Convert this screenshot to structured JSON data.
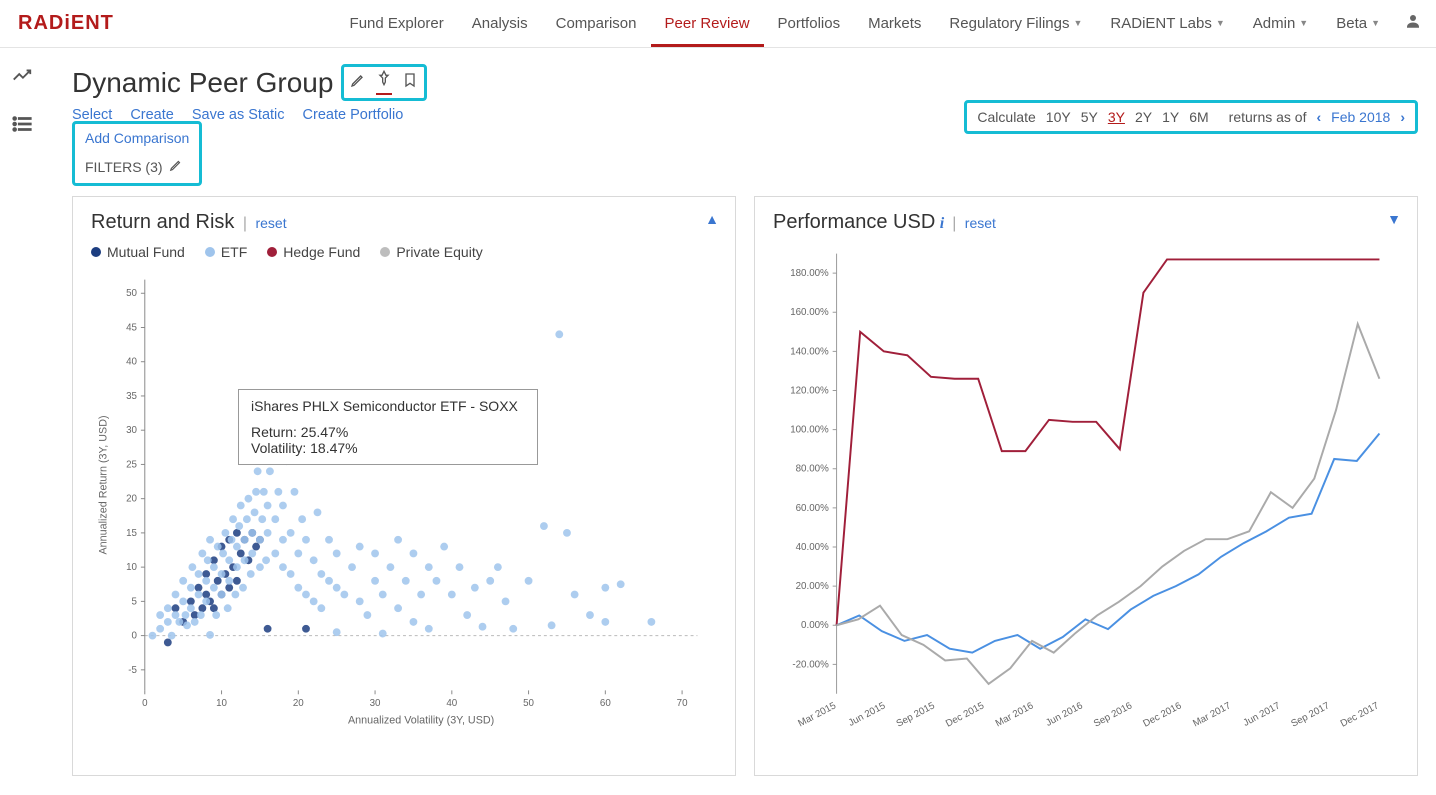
{
  "brand": "RADiENT",
  "nav": {
    "items": [
      {
        "label": "Fund Explorer",
        "dropdown": false
      },
      {
        "label": "Analysis",
        "dropdown": false
      },
      {
        "label": "Comparison",
        "dropdown": false
      },
      {
        "label": "Peer Review",
        "dropdown": false,
        "active": true
      },
      {
        "label": "Portfolios",
        "dropdown": false
      },
      {
        "label": "Markets",
        "dropdown": false
      },
      {
        "label": "Regulatory Filings",
        "dropdown": true
      },
      {
        "label": "RADiENT Labs",
        "dropdown": true
      },
      {
        "label": "Admin",
        "dropdown": true
      },
      {
        "label": "Beta",
        "dropdown": true
      }
    ]
  },
  "page": {
    "title": "Dynamic Peer Group",
    "actions": [
      "Select",
      "Create",
      "Save as Static",
      "Create Portfolio"
    ],
    "add_comparison": "Add Comparison",
    "filters_label": "FILTERS (3)"
  },
  "calc": {
    "prefix": "Calculate",
    "periods": [
      "10Y",
      "5Y",
      "3Y",
      "2Y",
      "1Y",
      "6M"
    ],
    "selected": "3Y",
    "suffix": "returns as of",
    "date": "Feb 2018"
  },
  "return_risk": {
    "title": "Return and Risk",
    "reset": "reset",
    "legend": [
      {
        "label": "Mutual Fund",
        "color": "#1c3d80"
      },
      {
        "label": "ETF",
        "color": "#9fc4ec"
      },
      {
        "label": "Hedge Fund",
        "color": "#a01f3a"
      },
      {
        "label": "Private Equity",
        "color": "#bdbdbd"
      }
    ],
    "xlabel": "Annualized Volatility (3Y, USD)",
    "ylabel": "Annualized Return (3Y, USD)",
    "tooltip": {
      "name": "iShares PHLX Semiconductor ETF - SOXX",
      "return": "Return: 25.47%",
      "vol": "Volatility: 18.47%"
    }
  },
  "perf": {
    "title": "Performance USD",
    "reset": "reset"
  },
  "chart_data": {
    "scatter": {
      "type": "scatter",
      "title": "Return and Risk",
      "xlabel": "Annualized Volatility (3Y, USD)",
      "ylabel": "Annualized Return (3Y, USD)",
      "xlim": [
        0,
        72
      ],
      "ylim": [
        -8,
        52
      ],
      "xticks": [
        0,
        10,
        20,
        30,
        40,
        50,
        60,
        70
      ],
      "yticks": [
        -5,
        0,
        5,
        10,
        15,
        20,
        25,
        30,
        35,
        40,
        45,
        50
      ],
      "series": [
        {
          "name": "Mutual Fund",
          "color": "#1c3d80",
          "points": [
            [
              3,
              -1
            ],
            [
              4,
              4
            ],
            [
              5,
              2
            ],
            [
              6,
              5
            ],
            [
              6.5,
              3
            ],
            [
              7,
              7
            ],
            [
              7.5,
              4
            ],
            [
              8,
              6
            ],
            [
              8,
              9
            ],
            [
              8.5,
              5
            ],
            [
              9,
              11
            ],
            [
              9,
              4
            ],
            [
              9.5,
              8
            ],
            [
              10,
              13
            ],
            [
              10,
              6
            ],
            [
              10.5,
              9
            ],
            [
              11,
              14
            ],
            [
              11,
              7
            ],
            [
              11.5,
              10
            ],
            [
              12,
              15
            ],
            [
              12,
              8
            ],
            [
              12.5,
              12
            ],
            [
              13,
              14
            ],
            [
              13.5,
              11
            ],
            [
              14,
              15
            ],
            [
              14.5,
              13
            ],
            [
              15,
              14
            ],
            [
              16,
              1
            ],
            [
              21,
              1
            ]
          ]
        },
        {
          "name": "ETF",
          "color": "#9fc4ec",
          "points": [
            [
              1,
              0
            ],
            [
              2,
              1
            ],
            [
              2,
              3
            ],
            [
              3,
              2
            ],
            [
              3,
              4
            ],
            [
              3.5,
              0
            ],
            [
              4,
              3
            ],
            [
              4,
              6
            ],
            [
              4.5,
              2
            ],
            [
              5,
              5
            ],
            [
              5,
              8
            ],
            [
              5.3,
              3
            ],
            [
              5.5,
              1.5
            ],
            [
              6,
              4
            ],
            [
              6,
              7
            ],
            [
              6.2,
              10
            ],
            [
              6.5,
              2
            ],
            [
              7,
              6
            ],
            [
              7,
              9
            ],
            [
              7.3,
              3
            ],
            [
              7.5,
              12
            ],
            [
              8,
              5
            ],
            [
              8,
              8
            ],
            [
              8.2,
              11
            ],
            [
              8.5,
              0.1
            ],
            [
              8.5,
              14
            ],
            [
              9,
              7
            ],
            [
              9,
              10
            ],
            [
              9.3,
              3
            ],
            [
              9.5,
              13
            ],
            [
              10,
              6
            ],
            [
              10,
              9
            ],
            [
              10.2,
              12
            ],
            [
              10.5,
              15
            ],
            [
              10.8,
              4
            ],
            [
              11,
              8
            ],
            [
              11,
              11
            ],
            [
              11.3,
              14
            ],
            [
              11.5,
              17
            ],
            [
              11.8,
              6
            ],
            [
              12,
              10
            ],
            [
              12,
              13
            ],
            [
              12.3,
              16
            ],
            [
              12.5,
              19
            ],
            [
              12.8,
              7
            ],
            [
              13,
              11
            ],
            [
              13,
              14
            ],
            [
              13.3,
              17
            ],
            [
              13.5,
              20
            ],
            [
              13.8,
              9
            ],
            [
              14,
              12
            ],
            [
              14,
              15
            ],
            [
              14.3,
              18
            ],
            [
              14.5,
              21
            ],
            [
              14.7,
              24
            ],
            [
              15,
              10
            ],
            [
              15,
              14
            ],
            [
              15.3,
              17
            ],
            [
              15.5,
              21
            ],
            [
              15.8,
              11
            ],
            [
              16,
              15
            ],
            [
              16,
              19
            ],
            [
              16.3,
              24
            ],
            [
              17,
              12
            ],
            [
              17,
              17
            ],
            [
              17.4,
              21
            ],
            [
              18,
              10
            ],
            [
              18,
              14
            ],
            [
              18,
              19
            ],
            [
              18.47,
              25.47
            ],
            [
              19,
              9
            ],
            [
              19,
              15
            ],
            [
              19.5,
              21
            ],
            [
              20,
              7
            ],
            [
              20,
              12
            ],
            [
              20.5,
              17
            ],
            [
              21,
              6
            ],
            [
              21,
              14
            ],
            [
              22,
              5
            ],
            [
              22,
              11
            ],
            [
              22.5,
              18
            ],
            [
              23,
              4
            ],
            [
              23,
              9
            ],
            [
              24,
              8
            ],
            [
              24,
              14
            ],
            [
              25,
              0.5
            ],
            [
              25,
              7
            ],
            [
              25,
              12
            ],
            [
              26,
              6
            ],
            [
              27,
              10
            ],
            [
              28,
              5
            ],
            [
              28,
              13
            ],
            [
              29,
              3
            ],
            [
              30,
              8
            ],
            [
              30,
              12
            ],
            [
              31,
              0.3
            ],
            [
              31,
              6
            ],
            [
              32,
              10
            ],
            [
              33,
              14
            ],
            [
              33,
              4
            ],
            [
              34,
              8
            ],
            [
              35,
              12
            ],
            [
              35,
              2
            ],
            [
              36,
              6
            ],
            [
              37,
              10
            ],
            [
              37,
              1
            ],
            [
              38,
              8
            ],
            [
              39,
              13
            ],
            [
              40,
              6
            ],
            [
              41,
              10
            ],
            [
              42,
              3
            ],
            [
              43,
              7
            ],
            [
              44,
              1.3
            ],
            [
              45,
              8
            ],
            [
              46,
              10
            ],
            [
              46.5,
              31
            ],
            [
              47,
              5
            ],
            [
              48,
              1
            ],
            [
              50,
              8
            ],
            [
              52,
              16
            ],
            [
              53,
              1.5
            ],
            [
              54,
              44
            ],
            [
              55,
              15
            ],
            [
              56,
              6
            ],
            [
              58,
              3
            ],
            [
              60,
              7
            ],
            [
              60,
              2
            ],
            [
              62,
              7.5
            ],
            [
              66,
              2
            ]
          ]
        },
        {
          "name": "Hedge Fund",
          "color": "#a01f3a",
          "points": []
        },
        {
          "name": "Private Equity",
          "color": "#bdbdbd",
          "points": []
        }
      ]
    },
    "performance": {
      "type": "line",
      "title": "Performance USD",
      "ylabel": "%",
      "ylim": [
        -35,
        190
      ],
      "yticks": [
        "-20.00%",
        "0.00%",
        "20.00%",
        "40.00%",
        "60.00%",
        "80.00%",
        "100.00%",
        "120.00%",
        "140.00%",
        "160.00%",
        "180.00%"
      ],
      "x": [
        "Mar 2015",
        "Jun 2015",
        "Sep 2015",
        "Dec 2015",
        "Mar 2016",
        "Jun 2016",
        "Sep 2016",
        "Dec 2016",
        "Mar 2017",
        "Jun 2017",
        "Sep 2017",
        "Dec 2017"
      ],
      "series": [
        {
          "name": "Red",
          "color": "#a01f3a",
          "values": [
            0,
            150,
            140,
            138,
            127,
            126,
            126,
            89,
            89,
            105,
            104,
            104,
            90,
            170,
            187,
            187,
            187,
            187,
            187,
            187,
            187,
            187,
            187,
            187
          ]
        },
        {
          "name": "Blue",
          "color": "#4a90e2",
          "values": [
            0,
            5,
            -3,
            -8,
            -5,
            -12,
            -14,
            -8,
            -5,
            -12,
            -6,
            3,
            -2,
            8,
            15,
            20,
            26,
            35,
            42,
            48,
            55,
            57,
            85,
            84,
            98
          ]
        },
        {
          "name": "Grey",
          "color": "#aaaaaa",
          "values": [
            0,
            3,
            10,
            -5,
            -10,
            -18,
            -17,
            -30,
            -22,
            -8,
            -14,
            -4,
            5,
            12,
            20,
            30,
            38,
            44,
            44,
            48,
            68,
            60,
            75,
            110,
            154,
            126
          ]
        }
      ]
    }
  }
}
